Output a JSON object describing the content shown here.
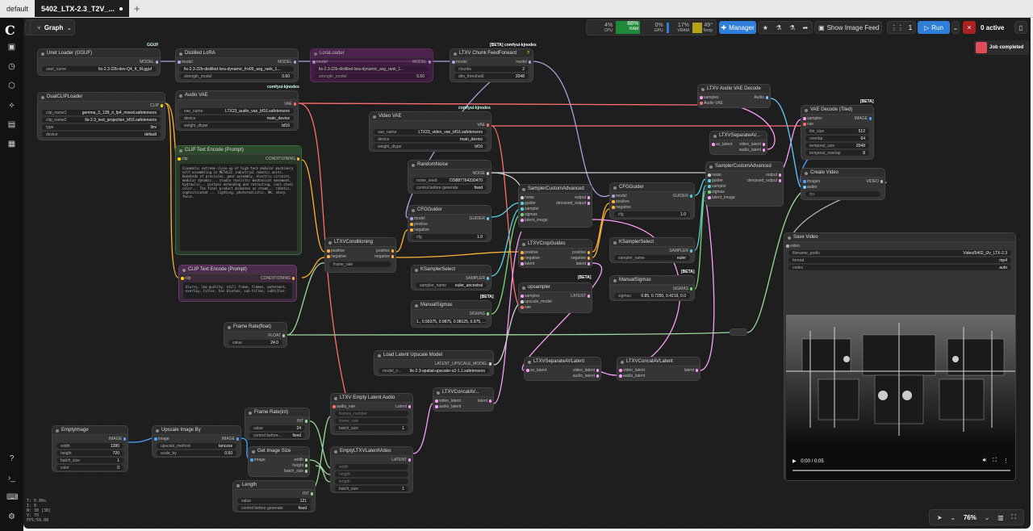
{
  "tabs": {
    "workspace": "default",
    "active": "5402_LTX-2.3_T2V_..."
  },
  "toolbar": {
    "mode": "Graph",
    "cpu_pct": "4%",
    "cpu_lbl": "CPU",
    "ram_pct": "88%",
    "ram_lbl": "RAM",
    "gpu_pct": "0%",
    "gpu_lbl": "GPU",
    "vram_pct": "17%",
    "vram_lbl": "VRAM",
    "temp": "49°",
    "temp_lbl": "Temp",
    "manager": "Manager",
    "feed": "Show Image Feed",
    "queue": "1",
    "run": "Run",
    "active": "0 active",
    "job": "Job completed"
  },
  "status": {
    "lines": [
      "T: 0.00s",
      "I: 0",
      "N: 38 [38]",
      "V: 70",
      "FPS:59.88"
    ]
  },
  "zoom": "76%",
  "nodes": {
    "unet": {
      "title": "Unet Loader (GGUF)",
      "out": "MODEL",
      "w1l": "unet_name",
      "w1v": "ltx-2.3-22b-dev-Q4_K_M.gguf",
      "badge": "GGUF"
    },
    "lora": {
      "title": "Distilled LoRA",
      "in": "model",
      "out": "MODEL",
      "w1v": "ltx-2.3-22b-distilled-lora-dynamic_fro09_avg_rank_1...",
      "w2l": "strength_model",
      "w2v": "0.60"
    },
    "lorabyp": {
      "title": "LoraLoader",
      "in": "model",
      "out": "MODEL",
      "w1v": "ltx-2.3-22b-distilled-lora-dynamic_avg_rank_1...",
      "w2l": "strength_model",
      "w2v": "0.60"
    },
    "chunk": {
      "title": "LTXV Chunk FeedForward",
      "in": "model",
      "out": "model",
      "badge": "[BETA] comfyui-kjnodes",
      "w1l": "chunks",
      "w1v": "2",
      "w2l": "dim_threshold",
      "w2v": "2048",
      "q": "?"
    },
    "dualclip": {
      "title": "DualCLIPLoader",
      "out": "CLIP",
      "w1l": "clip_name1",
      "w1v": "gemma_3_12B_it_fp4_mixed.safetensors",
      "w2l": "clip_name2",
      "w2v": "ltx-2.3_text_projection_bf16.safetensors",
      "w3l": "type",
      "w3v": "ltxv",
      "w4l": "device",
      "w4v": "default"
    },
    "audiovae": {
      "title": "Audio VAE",
      "out": "VAE",
      "w1l": "vae_name",
      "w1v": "LTX23_audio_vae_bf16.safetensors",
      "w2l": "device",
      "w2v": "main_device",
      "w3l": "weight_dtype",
      "w3v": "bf16",
      "badge": "comfyui-kjnodes"
    },
    "clippos": {
      "title": "CLIP Text Encode (Prompt)",
      "in": "clip",
      "out": "CONDITIONING",
      "text": "Cinematic extreme close-up of high-tech modular machinery self-assembling in METALIC industrial robotic units. Hundreds of precision, gear assembly, electric circuits, modular dynamic... studio realistic mechanical movement, hydraulic... pistons extending and retracting, cool steel color... The final product animates as steam... robotic, sophisticated ... lighting, photorealistic, 8K, sharp focus."
    },
    "clipneg": {
      "title": "CLIP Text Encode (Prompt)",
      "in": "clip",
      "out": "CONDITIONING",
      "text": "blurry, low quality, still frame, frames, watermark, overlay, titles, has blurbox, sub-titles, subtitles"
    },
    "videovae": {
      "title": "Video VAE",
      "out": "VAE",
      "w1l": "vae_name",
      "w1v": "LTX23_video_vae_bf16.safetensors",
      "w2l": "device",
      "w2v": "main_device",
      "w3l": "weight_dtype",
      "w3v": "bf16",
      "badge": "comfyui-kjnodes"
    },
    "noise": {
      "title": "RandomNoise",
      "out": "NOISE",
      "w1l": "noise_seed",
      "w1v": "729887764330470",
      "w2l": "control before generate",
      "w2v": "fixed"
    },
    "cfg1": {
      "title": "CFGGuider",
      "in1": "model",
      "in2": "positive",
      "in3": "negative",
      "out": "GUIDER",
      "w1l": "cfg",
      "w1v": "1.0"
    },
    "ltxcond": {
      "title": "LTXVConditioning",
      "in1": "positive",
      "in2": "negative",
      "out1": "positive",
      "out2": "negative",
      "w1l": "frame_rate"
    },
    "ksel1": {
      "title": "KSamplerSelect",
      "out": "SAMPLER",
      "w1l": "sampler_name",
      "w1v": "euler_ancestral"
    },
    "manual1": {
      "title": "ManualSigmas",
      "out": "SIGMAS",
      "w1v": "1., 0.99375, 0.9875, 0.98125, 0.975, ...",
      "badge": "[BETA]"
    },
    "sca1": {
      "title": "SamplerCustomAdvanced",
      "in": [
        "noise",
        "guider",
        "sampler",
        "sigmas",
        "latent_image"
      ],
      "out1": "output",
      "out2": "denoised_output"
    },
    "crop": {
      "title": "LTXVCropGuides",
      "in": [
        "positive",
        "negative",
        "latent"
      ],
      "out": [
        "positive",
        "negative",
        "latent"
      ],
      "badge": "[BETA]"
    },
    "upsampler": {
      "title": "upsampler",
      "in": [
        "samples",
        "upscale_model",
        "vae"
      ],
      "out": "LATENT"
    },
    "cfg2": {
      "title": "CFGGuider",
      "in1": "model",
      "in2": "positive",
      "in3": "negative",
      "out": "GUIDER",
      "w1l": "cfg",
      "w1v": "1.0"
    },
    "ksel2": {
      "title": "KSamplerSelect",
      "out": "SAMPLER",
      "w1l": "sampler_name",
      "w1v": "euler"
    },
    "manual2": {
      "title": "ManualSigmas",
      "out": "SIGMAS",
      "w1l": "sigmas",
      "w1v": "0.85, 0.7250, 0.4219, 0.0",
      "badge": "[BETA]"
    },
    "audiodec": {
      "title": "LTXV Audio VAE Decode",
      "in1": "samples",
      "in2": "Audio VAE",
      "out": "Audio"
    },
    "sep1": {
      "title": "LTXVSeparateAV...",
      "in": "av_latent",
      "out1": "video_latent",
      "out2": "audio_latent"
    },
    "sca2": {
      "title": "SamplerCustomAdvanced",
      "in": [
        "noise",
        "guider",
        "sampler",
        "sigmas",
        "latent_image"
      ],
      "out1": "output",
      "out2": "denoised_output"
    },
    "vaedecode": {
      "title": "VAE Decode (Tiled)",
      "in1": "samples",
      "in2": "vae",
      "out": "IMAGE",
      "badge": "[BETA]",
      "w1l": "tile_size",
      "w1v": "512",
      "w2l": "overlap",
      "w2v": "64",
      "w3l": "temporal_size",
      "w3v": "2048",
      "w4l": "temporal_overlap",
      "w4v": "8"
    },
    "createvideo": {
      "title": "Create Video",
      "in": [
        "images",
        "audio",
        "fps"
      ],
      "out": "VIDEO"
    },
    "savevideo": {
      "title": "Save Video",
      "in": "video",
      "w1l": "filename_prefix",
      "w1v": "Video/5402_i2v_LTX-2.3",
      "w2l": "format",
      "w2v": "mp4",
      "w3l": "codec",
      "w3v": "auto",
      "time": "0:00 / 0:05"
    },
    "fps": {
      "title": "Frame Rate(float)",
      "out": "FLOAT",
      "w1l": "value",
      "w1v": "24.0"
    },
    "upmodel": {
      "title": "Load Latent Upscale Model",
      "out": "LATENT_UPSCALE_MODEL",
      "w1l": "model_n...",
      "w1v": "ltx-2.3-spatial-upscaler-x2-1.1.safetensors"
    },
    "sep2": {
      "title": "LTXVSeparateAVLatent",
      "in": "av_latent",
      "out1": "video_latent",
      "out2": "audio_latent"
    },
    "concat2": {
      "title": "LTXVConcatAVLatent",
      "in1": "video_latent",
      "in2": "audio_latent",
      "out": "latent"
    },
    "emptyaudio": {
      "title": "LTXV Empty Latent Audio",
      "in1": "audio_vae",
      "out": "Latent",
      "w1l": "frames_number",
      "w2l": "frame_rate",
      "w3l": "batch_size",
      "w3v": "1"
    },
    "concat1": {
      "title": "LTXVConcatAV...",
      "in1": "video_latent",
      "in2": "audio_latent",
      "out": "latent"
    },
    "framerateint": {
      "title": "Frame Rate(int)",
      "out": "INT",
      "w1l": "value",
      "w1v": "24",
      "w2l": "control before...",
      "w2v": "fixed"
    },
    "getsize": {
      "title": "Get Image Size",
      "in": "image",
      "out1": "width",
      "out2": "height",
      "out3": "batch_size"
    },
    "emptyltxv": {
      "title": "EmptyLTXVLatentVideo",
      "out": "LATENT",
      "w1l": "width",
      "w2l": "height",
      "w3l": "length",
      "w4l": "batch_size",
      "w4v": "1"
    },
    "length": {
      "title": "Length",
      "out": "INT",
      "w1l": "value",
      "w1v": "121",
      "w2l": "control before generate",
      "w2v": "fixed"
    },
    "emptyimage": {
      "title": "EmptyImage",
      "out": "IMAGE",
      "w1l": "width",
      "w1v": "1280",
      "w2l": "height",
      "w2v": "720",
      "w3l": "batch_size",
      "w3v": "1",
      "w4l": "color",
      "w4v": "0"
    },
    "upscaleby": {
      "title": "Upscale Image By",
      "in": "image",
      "out": "IMAGE",
      "w1l": "upscale_method",
      "w1v": "lanczos",
      "w2l": "scale_by",
      "w2v": "0.50"
    }
  }
}
